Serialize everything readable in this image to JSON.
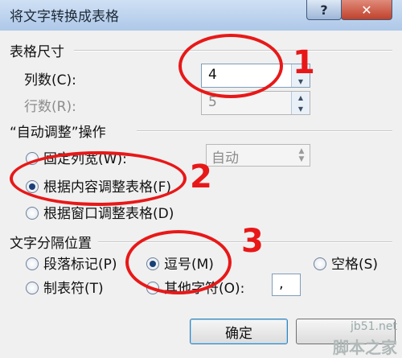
{
  "window": {
    "title": "将文字转换成表格",
    "help": "?",
    "close": "✕"
  },
  "table_size": {
    "title": "表格尺寸",
    "columns_label": "列数(C):",
    "columns_value": "4",
    "rows_label": "行数(R):",
    "rows_value": "5"
  },
  "autofit": {
    "title": "“自动调整”操作",
    "fixed_width_label": "固定列宽(W):",
    "fixed_width_value": "自动",
    "fit_contents_label": "根据内容调整表格(F)",
    "fit_window_label": "根据窗口调整表格(D)",
    "selected": "fit_contents"
  },
  "separator": {
    "title": "文字分隔位置",
    "paragraph_label": "段落标记(P)",
    "comma_label": "逗号(M)",
    "space_label": "空格(S)",
    "tab_label": "制表符(T)",
    "other_label": "其他字符(O):",
    "other_value": ",",
    "selected": "comma"
  },
  "buttons": {
    "ok": "确定"
  },
  "annotations": {
    "n1": "1",
    "n2": "2",
    "n3": "3",
    "color": "#e81818"
  },
  "watermark": {
    "line1": "jb51.net",
    "line2": "脚本之家"
  }
}
